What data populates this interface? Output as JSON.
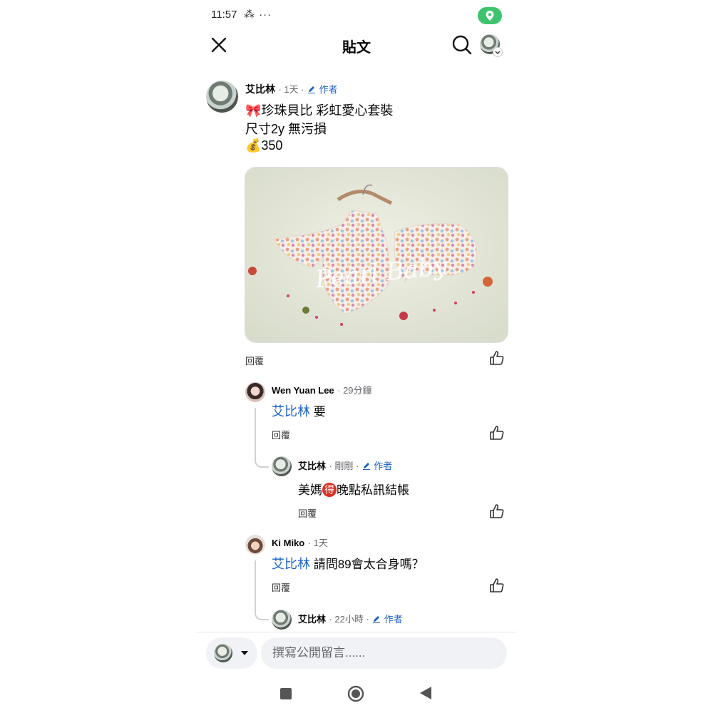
{
  "status_bar": {
    "time": "11:57",
    "icons": "⁂ ···"
  },
  "header": {
    "title": "貼文"
  },
  "post": {
    "author": "艾比林",
    "time": "· 1天 ·",
    "author_badge": "作者",
    "lines": [
      "🎀珍珠貝比 彩虹愛心套裝",
      "尺寸2y 無污損",
      "💰350"
    ],
    "image_watermark": "Pearl Baby",
    "reply_label": "回覆"
  },
  "comments": [
    {
      "author": "Wen Yuan Lee",
      "time": "· 29分鐘",
      "mention": "艾比林",
      "text": " 要",
      "reply_label": "回覆",
      "reply": {
        "author": "艾比林",
        "time": "· 剛剛 ·",
        "author_badge": "作者",
        "text_before": "美媽",
        "circled": "得",
        "text_after": "晚點私訊結帳",
        "reply_label": "回覆"
      }
    },
    {
      "author": "Ki Miko",
      "time": "· 1天",
      "mention": "艾比林",
      "text": " 請問89會太合身嗎？",
      "reply_label": "回覆",
      "reply": {
        "author": "艾比林",
        "time": "· 22小時 ·",
        "author_badge": "作者"
      }
    }
  ],
  "composer": {
    "placeholder": "撰寫公開留言......"
  }
}
